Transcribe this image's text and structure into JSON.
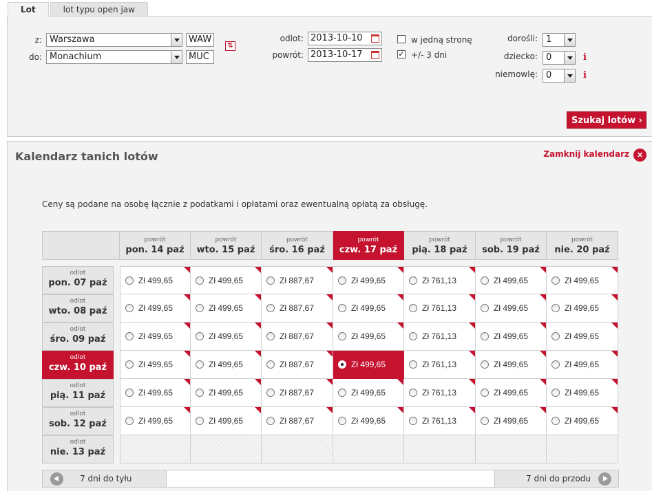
{
  "tabs": [
    {
      "label": "Lot",
      "active": true
    },
    {
      "label": "lot typu open jaw",
      "active": false
    }
  ],
  "search": {
    "from_label": "z:",
    "from_value": "Warszawa",
    "from_code": "WAW",
    "to_label": "do:",
    "to_value": "Monachium",
    "to_code": "MUC",
    "depart_label": "odlot:",
    "depart_value": "2013-10-10",
    "return_label": "powrót:",
    "return_value": "2013-10-17",
    "one_way_label": "w jedną stronę",
    "one_way_checked": false,
    "flex_label": "+/- 3 dni",
    "flex_checked": true,
    "adults_label": "dorośli:",
    "adults_value": "1",
    "children_label": "dziecko:",
    "children_value": "0",
    "infants_label": "niemowlę:",
    "infants_value": "0",
    "info_glyph": "i",
    "swap_glyph": "⇅",
    "search_button": "Szukaj lotów ›"
  },
  "calendar": {
    "title": "Kalendarz tanich lotów",
    "close_label": "Zamknij kalendarz",
    "close_glyph": "×",
    "note": "Ceny są podane na osobę łącznie z podatkami i opłatami oraz ewentualną opłatą za obsługę.",
    "return_word": "powrót",
    "depart_word": "odlot",
    "columns": [
      "pon. 14 paź",
      "wto. 15 paź",
      "śro. 16 paź",
      "czw. 17 paź",
      "pią. 18 paź",
      "sob. 19 paź",
      "nie. 20 paź"
    ],
    "rows": [
      "pon. 07 paź",
      "wto. 08 paź",
      "śro. 09 paź",
      "czw. 10 paź",
      "pią. 11 paź",
      "sob. 12 paź",
      "nie. 13 paź"
    ],
    "active_column": 3,
    "active_row": 3,
    "prices": [
      [
        "Zł 499,65",
        "Zł 499,65",
        "Zł 887,67",
        "Zł 499,65",
        "Zł 761,13",
        "Zł 499,65",
        "Zł 499,65"
      ],
      [
        "Zł 499,65",
        "Zł 499,65",
        "Zł 887,67",
        "Zł 499,65",
        "Zł 761,13",
        "Zł 499,65",
        "Zł 499,65"
      ],
      [
        "Zł 499,65",
        "Zł 499,65",
        "Zł 887,67",
        "Zł 499,65",
        "Zł 761,13",
        "Zł 499,65",
        "Zł 499,65"
      ],
      [
        "Zł 499,65",
        "Zł 499,65",
        "Zł 887,67",
        "Zł 499,65",
        "Zł 761,13",
        "Zł 499,65",
        "Zł 499,65"
      ],
      [
        "Zł 499,65",
        "Zł 499,65",
        "Zł 887,67",
        "Zł 499,65",
        "Zł 761,13",
        "Zł 499,65",
        "Zł 499,65"
      ],
      [
        "Zł 499,65",
        "Zł 499,65",
        "Zł 887,67",
        "Zł 499,65",
        "Zł 761,13",
        "Zł 499,65",
        "Zł 499,65"
      ],
      [
        null,
        null,
        null,
        null,
        null,
        null,
        null
      ]
    ],
    "prev_label": "7 dni do tyłu",
    "next_label": "7 dni do przodu"
  },
  "colors": {
    "accent": "#c4122f",
    "panel": "#f3f3f3",
    "header": "#e6e6e6"
  }
}
